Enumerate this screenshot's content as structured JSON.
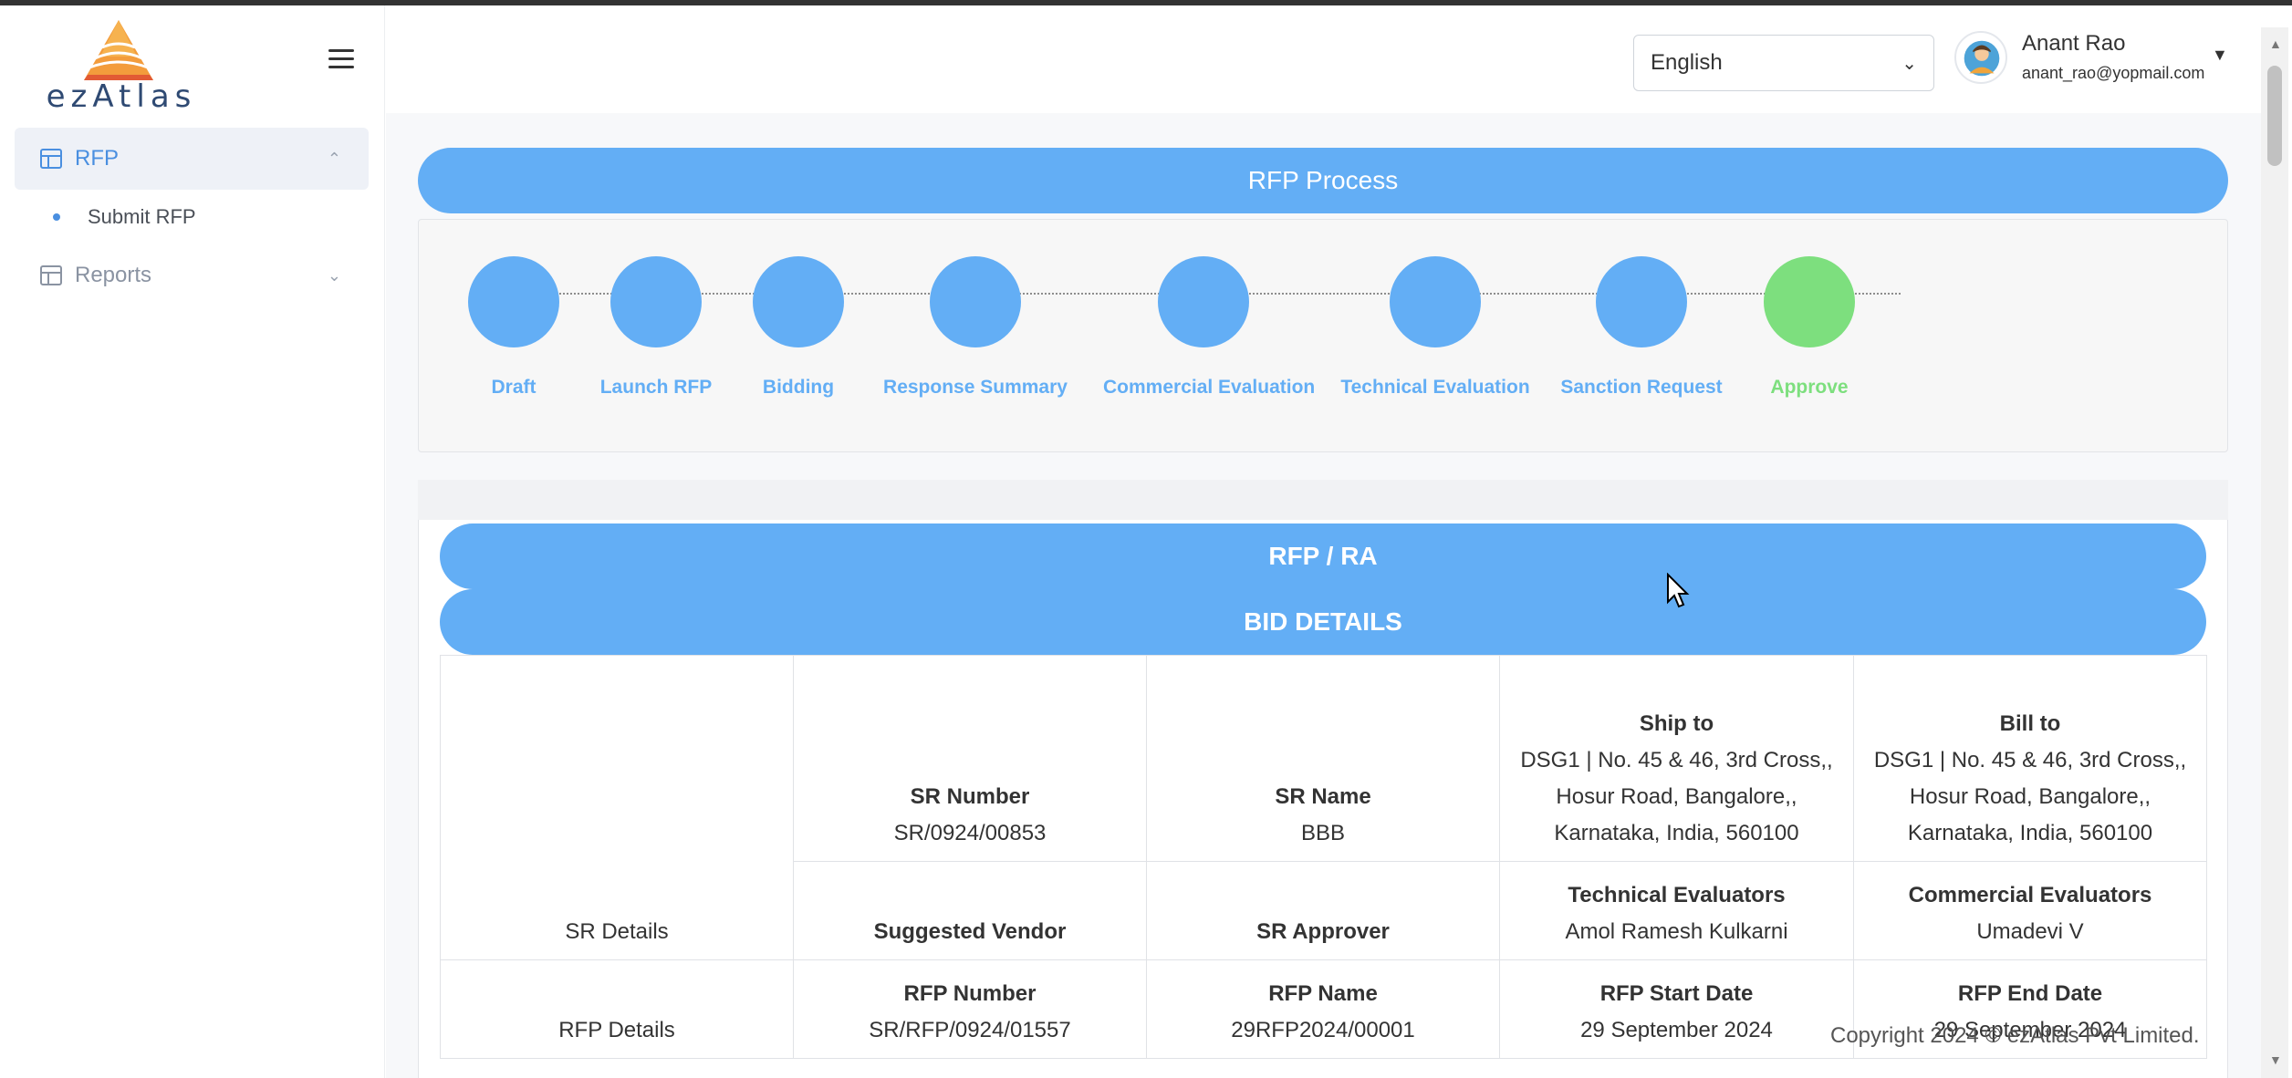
{
  "logo": {
    "text": "ezAtlas"
  },
  "sidebar": {
    "items": [
      {
        "label": "RFP",
        "icon": "table-icon",
        "expanded": true,
        "children": [
          {
            "label": "Submit RFP"
          }
        ]
      },
      {
        "label": "Reports",
        "icon": "table-icon",
        "expanded": false
      }
    ]
  },
  "header": {
    "language": "English",
    "user": {
      "name": "Anant Rao",
      "email": "anant_rao@yopmail.com"
    }
  },
  "process": {
    "title": "RFP Process",
    "steps": [
      {
        "label": "Draft"
      },
      {
        "label": "Launch RFP"
      },
      {
        "label": "Bidding"
      },
      {
        "label": "Response Summary"
      },
      {
        "label": "Commercial Evaluation"
      },
      {
        "label": "Technical Evaluation"
      },
      {
        "label": "Sanction Request"
      },
      {
        "label": "Approve"
      }
    ]
  },
  "sections": {
    "rfp_ra": "RFP / RA",
    "bid_details": "BID DETAILS"
  },
  "table": {
    "sr_details_label": "SR Details",
    "rfp_details_label": "RFP Details",
    "sr_number": {
      "h": "SR Number",
      "v": "SR/0924/00853"
    },
    "sr_name": {
      "h": "SR Name",
      "v": "BBB"
    },
    "ship_to": {
      "h": "Ship to",
      "v": "DSG1 | No. 45 & 46, 3rd Cross,, Hosur Road, Bangalore,, Karnataka, India, 560100"
    },
    "bill_to": {
      "h": "Bill to",
      "v": "DSG1 | No. 45 & 46, 3rd Cross,, Hosur Road, Bangalore,, Karnataka, India, 560100"
    },
    "suggested_vendor": {
      "h": "Suggested Vendor",
      "v": ""
    },
    "sr_approver": {
      "h": "SR Approver",
      "v": ""
    },
    "technical_evaluators": {
      "h": "Technical Evaluators",
      "v": "Amol Ramesh Kulkarni"
    },
    "commercial_evaluators": {
      "h": "Commercial Evaluators",
      "v": "Umadevi V"
    },
    "rfp_number": {
      "h": "RFP Number",
      "v": "SR/RFP/0924/01557"
    },
    "rfp_name": {
      "h": "RFP Name",
      "v": "29RFP2024/00001"
    },
    "rfp_start_date": {
      "h": "RFP Start Date",
      "v": "29 September 2024"
    },
    "rfp_end_date": {
      "h": "RFP End Date",
      "v": "29 September 2024"
    }
  },
  "footer": {
    "copyright": "Copyright 2024 © ezAtlas Pvt Limited."
  },
  "colors": {
    "accent": "#63aef5",
    "done": "#7ddf7e",
    "logo_text": "#2f4a73"
  }
}
